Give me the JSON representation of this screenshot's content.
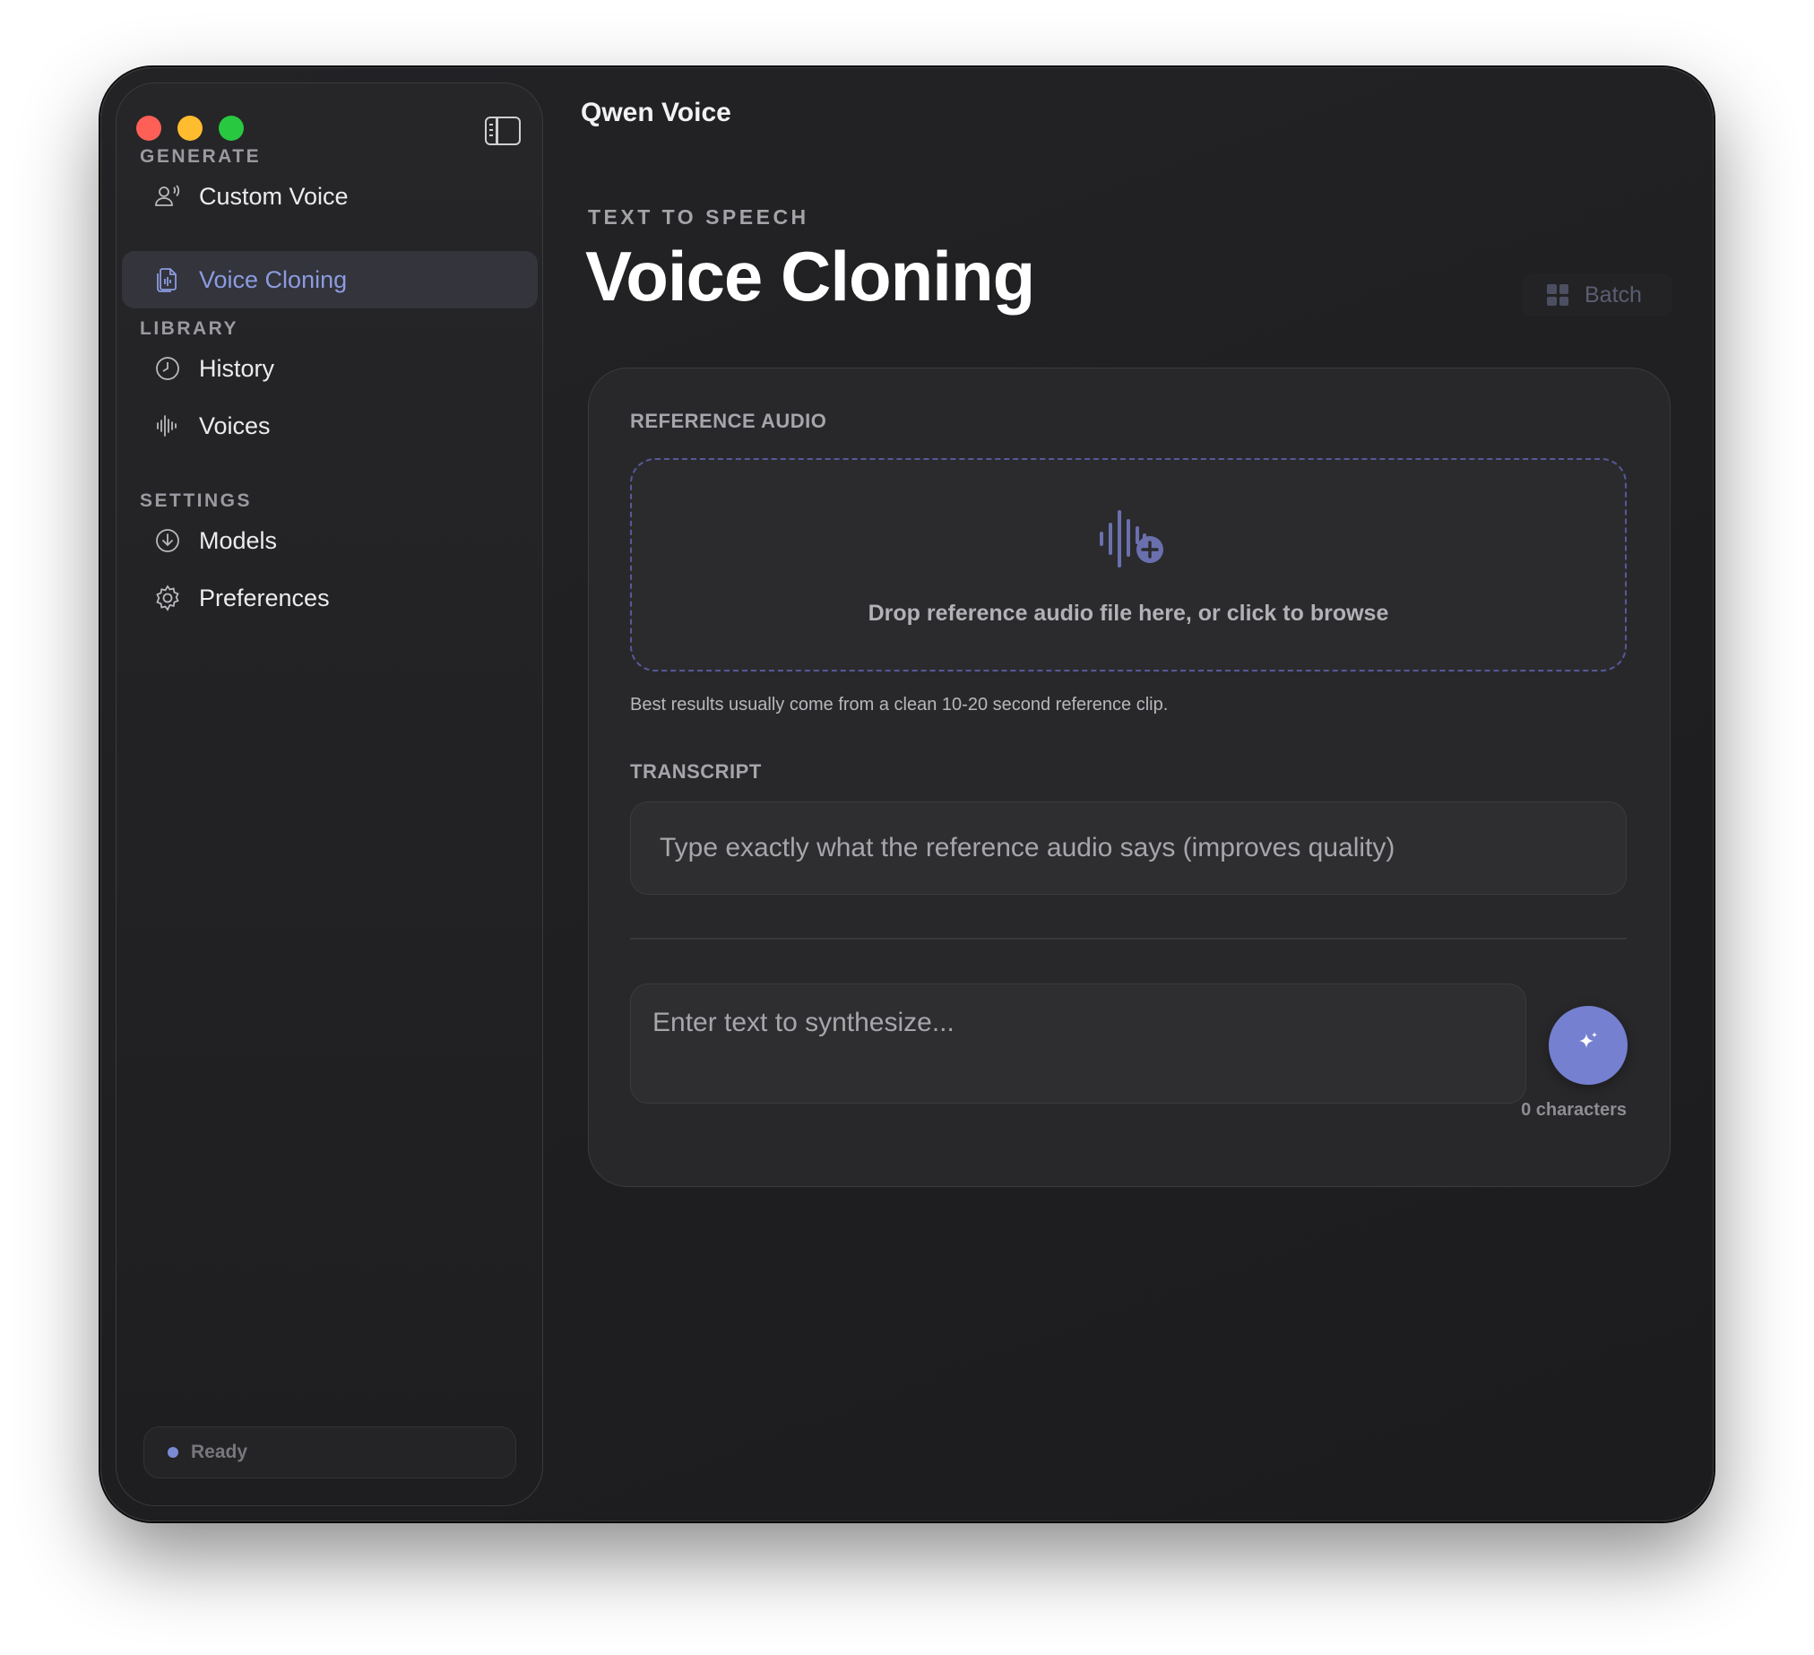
{
  "window": {
    "title": "Qwen Voice"
  },
  "sidebar": {
    "sections": [
      {
        "label": "GENERATE",
        "items": [
          {
            "label": "Custom Voice",
            "icon": "person-voice-icon",
            "active": false
          },
          {
            "label": "Voice Cloning",
            "icon": "document-copy-icon",
            "active": true
          }
        ]
      },
      {
        "label": "LIBRARY",
        "items": [
          {
            "label": "History",
            "icon": "clock-icon",
            "active": false
          },
          {
            "label": "Voices",
            "icon": "waveform-icon",
            "active": false
          }
        ]
      },
      {
        "label": "SETTINGS",
        "items": [
          {
            "label": "Models",
            "icon": "download-circle-icon",
            "active": false
          },
          {
            "label": "Preferences",
            "icon": "gear-icon",
            "active": false
          }
        ]
      }
    ],
    "status": "Ready"
  },
  "main": {
    "eyebrow": "TEXT TO SPEECH",
    "title": "Voice Cloning",
    "batch_label": "Batch",
    "reference_audio": {
      "label": "REFERENCE AUDIO",
      "dropzone_text": "Drop reference audio file here, or click to browse",
      "hint": "Best results usually come from a clean 10-20 second reference clip."
    },
    "transcript": {
      "label": "TRANSCRIPT",
      "placeholder": "Type exactly what the reference audio says (improves quality)"
    },
    "synthesize": {
      "placeholder": "Enter text to synthesize...",
      "char_count": "0 characters"
    }
  },
  "colors": {
    "accent": "#7580d0",
    "active_text": "#8c9be0",
    "traffic_red": "#fe5f57",
    "traffic_yellow": "#febc2e",
    "traffic_green": "#28c840"
  }
}
